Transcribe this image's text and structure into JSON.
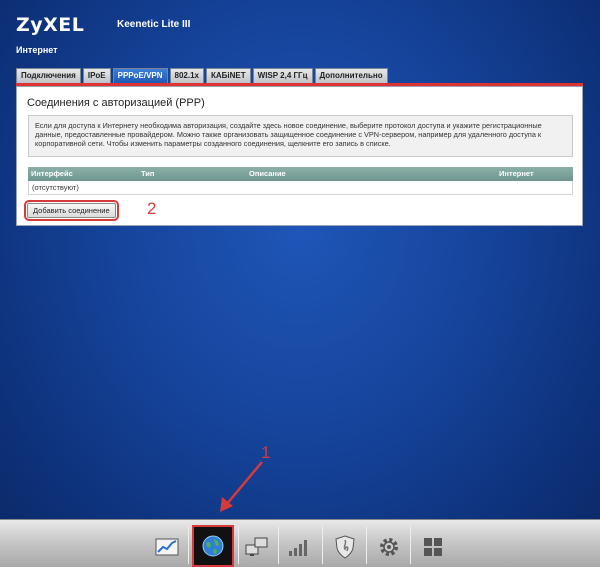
{
  "header": {
    "logo": "ZyXEL",
    "model": "Keenetic Lite III",
    "section": "Интернет"
  },
  "tabs": [
    {
      "label": "Подключения",
      "active": false
    },
    {
      "label": "IPoE",
      "active": false
    },
    {
      "label": "PPPoE/VPN",
      "active": true
    },
    {
      "label": "802.1x",
      "active": false
    },
    {
      "label": "КАБiNET",
      "active": false
    },
    {
      "label": "WISP 2,4 ГГц",
      "active": false
    },
    {
      "label": "Дополнительно",
      "active": false
    }
  ],
  "panel": {
    "title": "Соединения с авторизацией (PPP)",
    "info": "Если для доступа к Интернету необходима авторизация, создайте здесь новое соединение, выберите протокол доступа и укажите регистрационные данные, предоставленные провайдером. Можно также организовать защищенное соединение с VPN-сервером, например для удаленного доступа к корпоративной сети. Чтобы изменить параметры созданного соединения, щелкните его запись в списке.",
    "table": {
      "columns": [
        "Интерфейс",
        "Тип",
        "Описание",
        "Интернет"
      ],
      "empty_text": "(отсутствуют)"
    },
    "add_button": "Добавить соединение"
  },
  "annotations": {
    "marker_1": "1",
    "marker_2": "2",
    "color": "#d63a3a"
  },
  "bottom_nav": [
    {
      "icon": "chart-icon",
      "active": false
    },
    {
      "icon": "globe-icon",
      "active": true
    },
    {
      "icon": "network-icon",
      "active": false
    },
    {
      "icon": "signal-bars-icon",
      "active": false
    },
    {
      "icon": "shield-icon",
      "active": false
    },
    {
      "icon": "gear-icon",
      "active": false
    },
    {
      "icon": "apps-grid-icon",
      "active": false
    }
  ]
}
